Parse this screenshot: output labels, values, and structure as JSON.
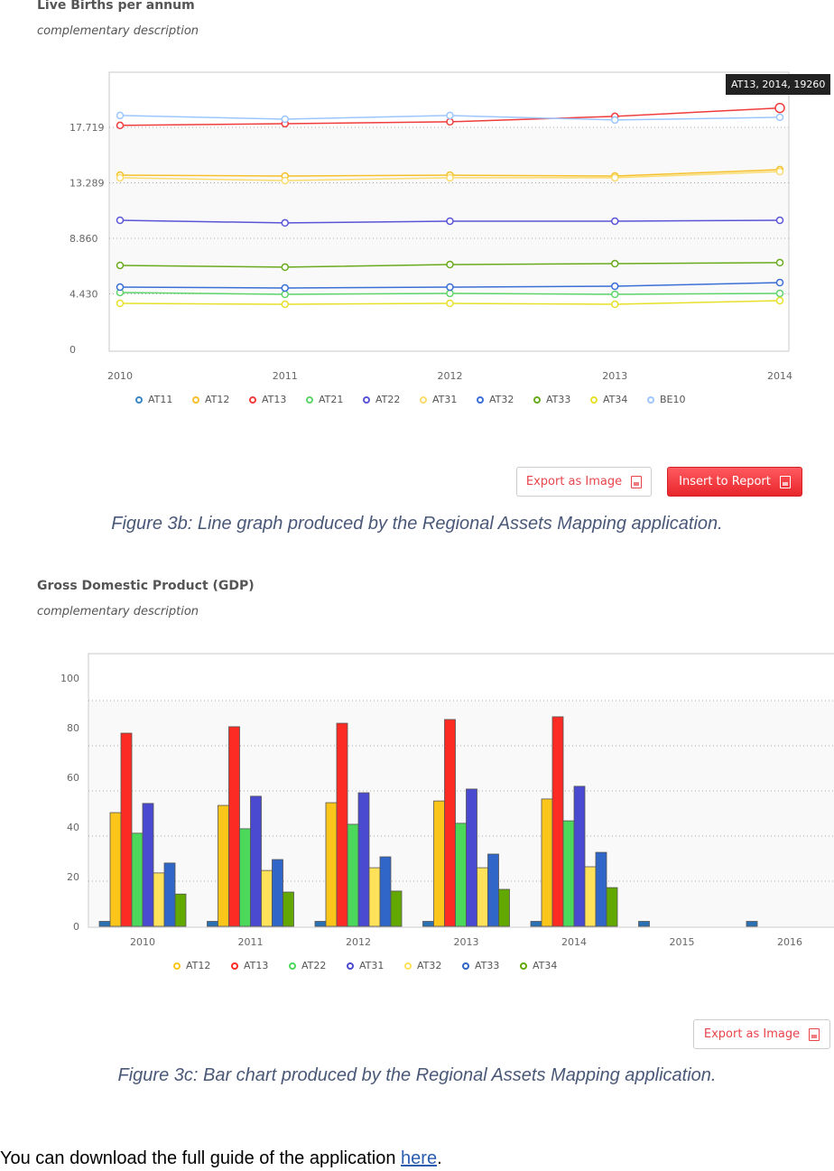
{
  "figure_b": {
    "title": "Live Births per annum",
    "description": "complementary description",
    "tooltip": "AT13, 2014, 19260",
    "buttons": {
      "export": "Export as Image",
      "insert": "Insert to Report"
    },
    "caption": "Figure 3b: Line graph produced by the Regional Assets Mapping application."
  },
  "figure_c": {
    "title": "Gross Domestic Product (GDP)",
    "description": "complementary description",
    "buttons": {
      "export": "Export as Image"
    },
    "caption": "Figure 3c: Bar chart produced by the Regional Assets Mapping application."
  },
  "footer": {
    "text": "You can download the full guide of the application ",
    "link": "here",
    "end": "."
  },
  "icons": {
    "export": "image-file-icon",
    "insert": "pdf-file-icon"
  },
  "chart_data": [
    {
      "type": "line",
      "title": "Live Births per annum",
      "x": [
        "2010",
        "2011",
        "2012",
        "2013",
        "2014"
      ],
      "y_ticks": [
        "0",
        "4.430",
        "8.860",
        "13.289",
        "17.719"
      ],
      "ylim": [
        0,
        22000
      ],
      "grid": true,
      "legend": "bottom",
      "series": [
        {
          "name": "AT11",
          "color": "#3a87c8",
          "values": []
        },
        {
          "name": "AT12",
          "color": "#f5c02a",
          "values": [
            13900,
            13830,
            13900,
            13830,
            14340
          ]
        },
        {
          "name": "AT13",
          "color": "#f03c3c",
          "values": [
            17870,
            18010,
            18160,
            18590,
            19260
          ]
        },
        {
          "name": "AT21",
          "color": "#5fd46a",
          "values": [
            4540,
            4390,
            4470,
            4390,
            4470
          ]
        },
        {
          "name": "AT22",
          "color": "#5a55d6",
          "values": [
            10300,
            10090,
            10230,
            10230,
            10300
          ]
        },
        {
          "name": "AT31",
          "color": "#fadc6e",
          "values": [
            13690,
            13470,
            13690,
            13690,
            14190
          ]
        },
        {
          "name": "AT32",
          "color": "#3a6fd6",
          "values": [
            4970,
            4900,
            4970,
            5040,
            5330
          ]
        },
        {
          "name": "AT33",
          "color": "#6aaa1e",
          "values": [
            6700,
            6560,
            6770,
            6840,
            6920
          ]
        },
        {
          "name": "AT34",
          "color": "#e6e02a",
          "values": [
            3670,
            3600,
            3670,
            3600,
            3890
          ]
        },
        {
          "name": "BE10",
          "color": "#9cc6ff",
          "values": [
            18660,
            18370,
            18660,
            18300,
            18520
          ]
        }
      ]
    },
    {
      "type": "bar",
      "title": "Gross Domestic Product (GDP)",
      "categories": [
        "2010",
        "2011",
        "2012",
        "2013",
        "2014",
        "2015",
        "2016"
      ],
      "y_ticks": [
        "0",
        "20",
        "40",
        "60",
        "80",
        "100"
      ],
      "ylim": [
        0,
        100
      ],
      "grid": true,
      "legend": "bottom",
      "series": [
        {
          "color": "#2a72b5",
          "values": [
            2,
            2,
            2,
            2,
            2,
            2,
            2
          ]
        },
        {
          "name": "AT12",
          "color": "#fbc51a",
          "values": [
            45.8,
            48.7,
            49.8,
            50.5,
            51.3,
            null,
            null
          ]
        },
        {
          "name": "AT13",
          "color": "#fc2c25",
          "values": [
            77.8,
            80.4,
            81.8,
            83.3,
            84.4,
            null,
            null
          ]
        },
        {
          "name": "AT22",
          "color": "#4cd85a",
          "values": [
            37.5,
            39.3,
            41.1,
            41.5,
            42.5,
            null,
            null
          ]
        },
        {
          "name": "AT31",
          "color": "#4a4ad0",
          "values": [
            49.5,
            52.4,
            53.8,
            55.3,
            56.4,
            null,
            null
          ]
        },
        {
          "name": "AT32",
          "color": "#ffe25a",
          "values": [
            21.5,
            22.5,
            23.6,
            23.6,
            24,
            null,
            null
          ]
        },
        {
          "name": "AT33",
          "color": "#2f66c8",
          "values": [
            25.5,
            26.9,
            28,
            29.1,
            29.8,
            null,
            null
          ]
        },
        {
          "name": "AT34",
          "color": "#62a800",
          "values": [
            13,
            13.8,
            14.2,
            14.9,
            15.6,
            null,
            null
          ]
        }
      ]
    }
  ]
}
